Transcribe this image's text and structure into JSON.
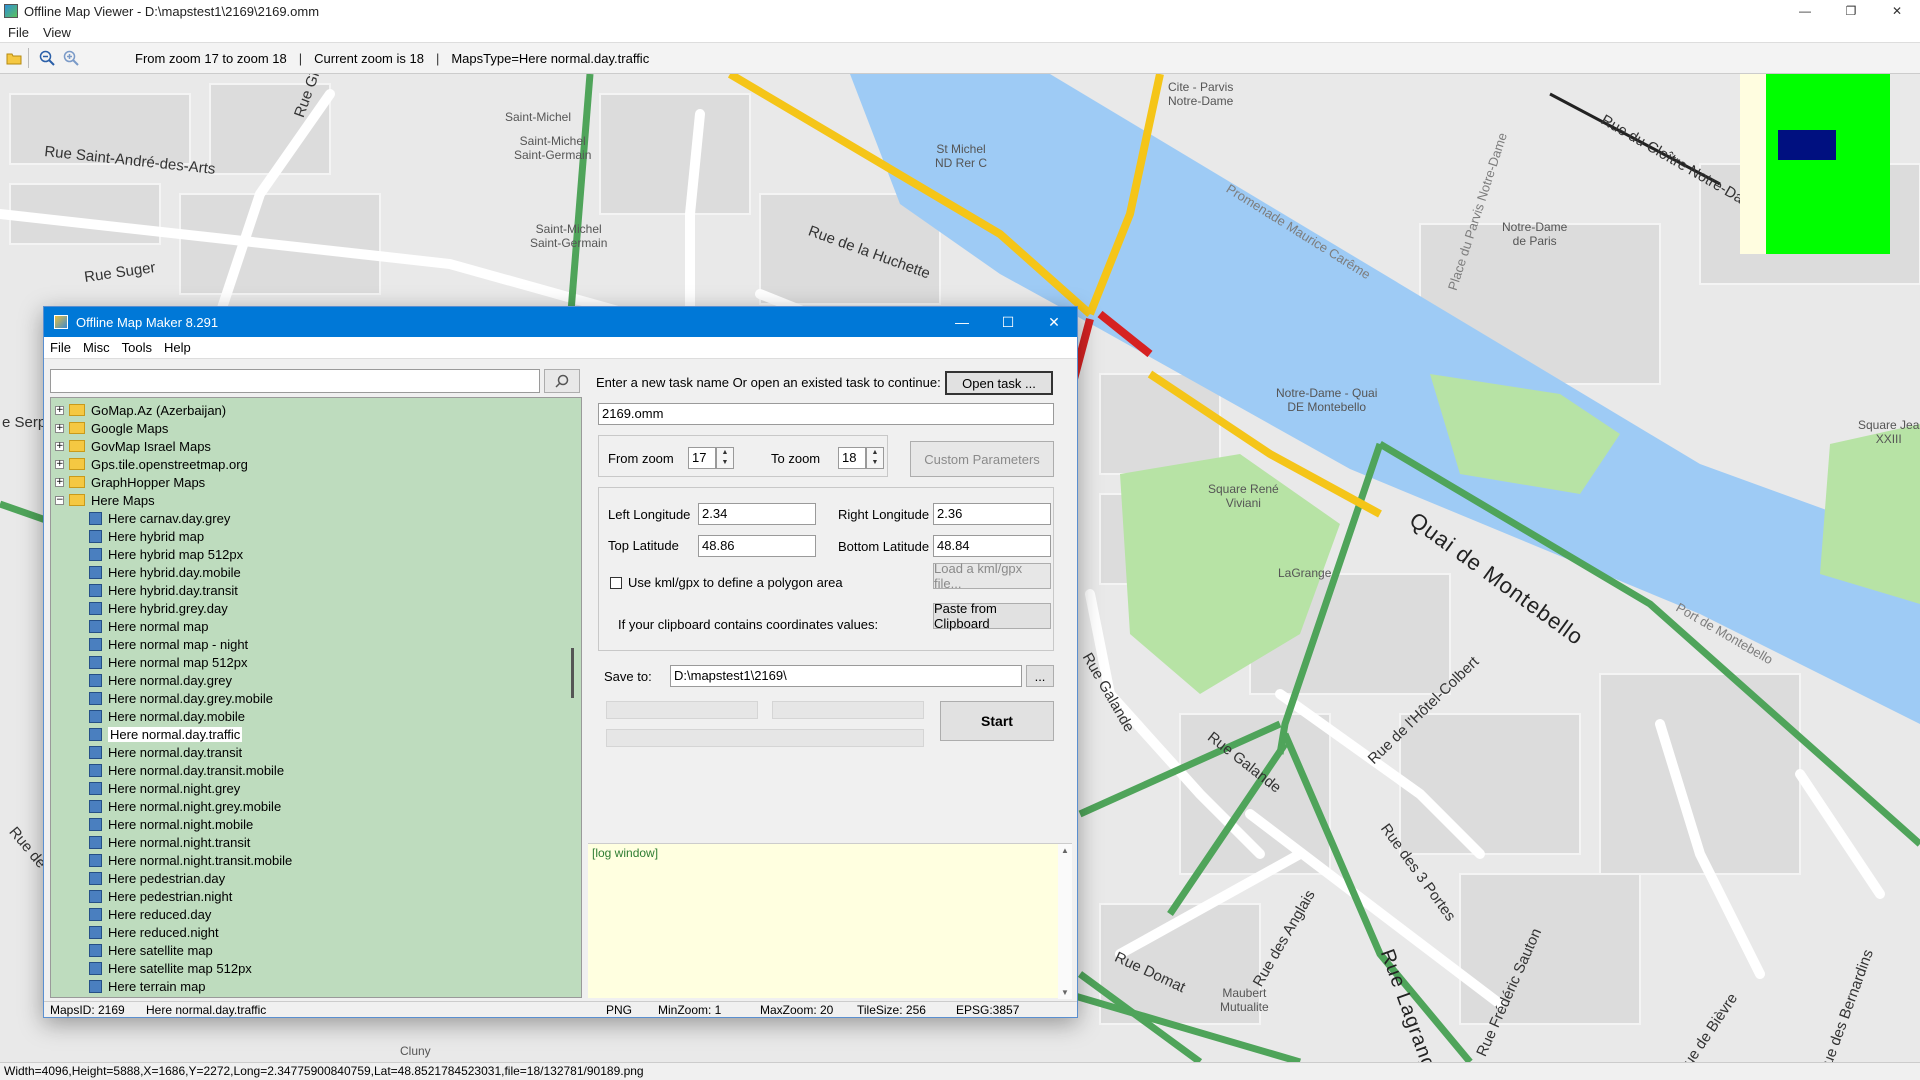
{
  "viewer": {
    "title": "Offline Map Viewer - D:\\mapstest1\\2169\\2169.omm",
    "menu": [
      "File",
      "View"
    ],
    "toolbar": {
      "zoom_range": "From zoom 17 to zoom 18",
      "current_zoom": "Current zoom is 18",
      "maps_type": "MapsType=Here normal.day.traffic",
      "sep": "|"
    },
    "status": "Width=4096,Height=5888,X=1686,Y=2272,Long=2.34775900840759,Lat=48.8521784523031,file=18/132781/90189.png"
  },
  "map_labels": {
    "rue_saint_andre": "Rue Saint-André-des-Arts",
    "rue_suger": "Rue Suger",
    "rue_git": "Rue Gît",
    "saint_michel_metro": "Saint-Michel",
    "saint_michel_saint_germain": "Saint-Michel\nSaint-Germain",
    "st_michel_nd": "St Michel\nND Rer C",
    "rue_huchette": "Rue de la Huchette",
    "cite": "Cite - Parvis\nNotre-Dame",
    "notre_dame_paris": "Notre-Dame\nde Paris",
    "promenade": "Promenade Maurice Carême",
    "place_parvis": "Place du Parvis Notre-Dame",
    "rue_cloitre": "Rue du Cloître Notre-Dame",
    "notre_dame_quai": "Notre-Dame - Quai\nDE Montebello",
    "square_rene": "Square René\nViviani",
    "quai_montebello": "Quai de Montebello",
    "port_montebello": "Port de Montebello",
    "lagrange": "LaGrange",
    "rue_galande": "Rue Galande",
    "rue_hotel_colbert": "Rue de l'Hôtel-Colbert",
    "rue_3_portes": "Rue des 3 Portes",
    "rue_domat": "Rue Domat",
    "rue_anglais": "Rue des Anglais",
    "rue_lagrange": "Rue Lagrange",
    "rue_frederic": "Rue Frédéric Sauton",
    "rue_bievre": "Rue de Bièvre",
    "rue_bernardins": "Rue des Bernardins",
    "maubert": "Maubert\nMutualite",
    "cluny": "Cluny",
    "square_jean": "Square Jea\nXXIII",
    "rue_serp": "e Serp",
    "rue_de_l": "Rue de l"
  },
  "dialog": {
    "title": "Offline Map Maker 8.291",
    "menu": [
      "File",
      "Misc",
      "Tools",
      "Help"
    ],
    "search": {
      "value": "",
      "placeholder": ""
    },
    "tree": [
      {
        "label": "GoMap.Az (Azerbaijan)",
        "level": 0,
        "type": "folder",
        "expander": "+"
      },
      {
        "label": "Google Maps",
        "level": 0,
        "type": "folder",
        "expander": "+"
      },
      {
        "label": "GovMap Israel Maps",
        "level": 0,
        "type": "folder",
        "expander": "+"
      },
      {
        "label": "Gps.tile.openstreetmap.org",
        "level": 0,
        "type": "folder",
        "expander": "+"
      },
      {
        "label": "GraphHopper Maps",
        "level": 0,
        "type": "folder",
        "expander": "+"
      },
      {
        "label": "Here Maps",
        "level": 0,
        "type": "folder-open",
        "expander": "−"
      },
      {
        "label": "Here carnav.day.grey",
        "level": 1,
        "type": "map"
      },
      {
        "label": "Here hybrid map",
        "level": 1,
        "type": "map"
      },
      {
        "label": "Here hybrid map 512px",
        "level": 1,
        "type": "map"
      },
      {
        "label": "Here hybrid.day.mobile",
        "level": 1,
        "type": "map"
      },
      {
        "label": "Here hybrid.day.transit",
        "level": 1,
        "type": "map"
      },
      {
        "label": "Here hybrid.grey.day",
        "level": 1,
        "type": "map"
      },
      {
        "label": "Here normal map",
        "level": 1,
        "type": "map"
      },
      {
        "label": "Here normal map - night",
        "level": 1,
        "type": "map"
      },
      {
        "label": "Here normal map 512px",
        "level": 1,
        "type": "map"
      },
      {
        "label": "Here normal.day.grey",
        "level": 1,
        "type": "map"
      },
      {
        "label": "Here normal.day.grey.mobile",
        "level": 1,
        "type": "map"
      },
      {
        "label": "Here normal.day.mobile",
        "level": 1,
        "type": "map"
      },
      {
        "label": "Here normal.day.traffic",
        "level": 1,
        "type": "map",
        "selected": true
      },
      {
        "label": "Here normal.day.transit",
        "level": 1,
        "type": "map"
      },
      {
        "label": "Here normal.day.transit.mobile",
        "level": 1,
        "type": "map"
      },
      {
        "label": "Here normal.night.grey",
        "level": 1,
        "type": "map"
      },
      {
        "label": "Here normal.night.grey.mobile",
        "level": 1,
        "type": "map"
      },
      {
        "label": "Here normal.night.mobile",
        "level": 1,
        "type": "map"
      },
      {
        "label": "Here normal.night.transit",
        "level": 1,
        "type": "map"
      },
      {
        "label": "Here normal.night.transit.mobile",
        "level": 1,
        "type": "map"
      },
      {
        "label": "Here pedestrian.day",
        "level": 1,
        "type": "map"
      },
      {
        "label": "Here pedestrian.night",
        "level": 1,
        "type": "map"
      },
      {
        "label": "Here reduced.day",
        "level": 1,
        "type": "map"
      },
      {
        "label": "Here reduced.night",
        "level": 1,
        "type": "map"
      },
      {
        "label": "Here satellite map",
        "level": 1,
        "type": "map"
      },
      {
        "label": "Here satellite map 512px",
        "level": 1,
        "type": "map"
      },
      {
        "label": "Here terrain map",
        "level": 1,
        "type": "map"
      }
    ],
    "task_prompt": "Enter a new task name Or open an existed task to continue:",
    "open_task": "Open task ...",
    "task_name": "2169.omm",
    "from_zoom_label": "From zoom",
    "from_zoom": "17",
    "to_zoom_label": "To zoom",
    "to_zoom": "18",
    "custom_params": "Custom Parameters",
    "left_lon_label": "Left Longitude",
    "left_lon": "2.34",
    "right_lon_label": "Right Longitude",
    "right_lon": "2.36",
    "top_lat_label": "Top Latitude",
    "top_lat": "48.86",
    "bottom_lat_label": "Bottom Latitude",
    "bottom_lat": "48.84",
    "kml_label": "Use kml/gpx to define a polygon area",
    "kml_checked": false,
    "load_kml": "Load a kml/gpx file...",
    "clipboard_label": "If your clipboard contains coordinates values:",
    "paste_clipboard": "Paste from Clipboard",
    "save_to_label": "Save to:",
    "save_to": "D:\\mapstest1\\2169\\",
    "browse": "...",
    "start": "Start",
    "log": "[log window]",
    "status": {
      "maps_id": "MapsID: 2169",
      "map_name": "Here normal.day.traffic",
      "format": "PNG",
      "min_zoom": "MinZoom: 1",
      "max_zoom": "MaxZoom: 20",
      "tile_size": "TileSize: 256",
      "epsg": "EPSG:3857"
    }
  },
  "colors": {
    "water": "#9ecbf5",
    "park": "#b7e3a5",
    "road_green": "#4fa45a",
    "road_yellow": "#f5c518",
    "road_red": "#d62222",
    "dialog_title": "#0078d7",
    "tree_bg": "#bedcbe",
    "log_bg": "#ffffe0"
  }
}
